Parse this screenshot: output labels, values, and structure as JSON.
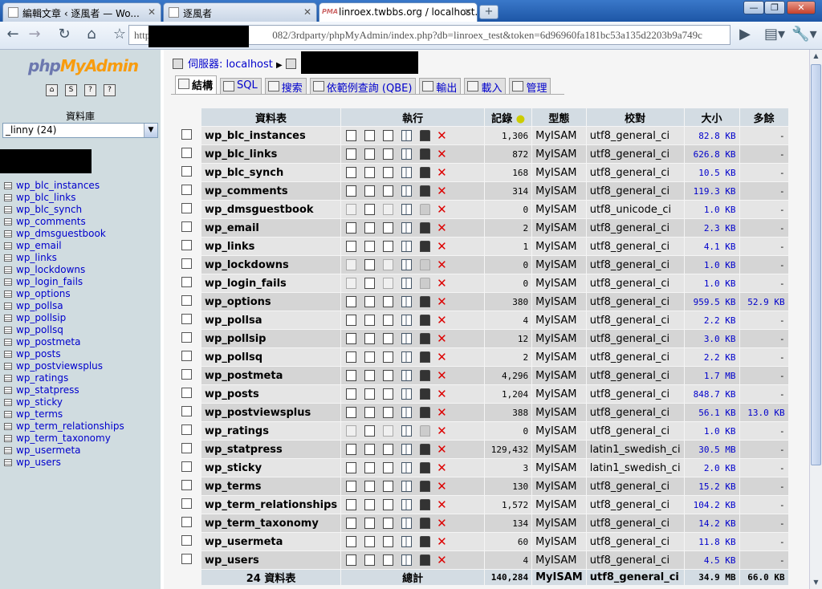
{
  "browser": {
    "tabs": [
      {
        "title": "編輯文章 ‹ 逐風者 — Wo..."
      },
      {
        "title": "逐風者"
      },
      {
        "title": "linroex.twbbs.org / localhost..."
      }
    ],
    "active_tab_index": 2,
    "address_visible": "082/3rdparty/phpMyAdmin/index.php?db=linroex_test&token=6d96960fa181bc53a135d2203b9a749c",
    "address_prefix": "http"
  },
  "sidebar": {
    "logo_php": "php",
    "logo_myadmin": "MyAdmin",
    "db_label": "資料庫",
    "db_selected": "_linny (24)",
    "tables": [
      "wp_blc_instances",
      "wp_blc_links",
      "wp_blc_synch",
      "wp_comments",
      "wp_dmsguestbook",
      "wp_email",
      "wp_links",
      "wp_lockdowns",
      "wp_login_fails",
      "wp_options",
      "wp_pollsa",
      "wp_pollsip",
      "wp_pollsq",
      "wp_postmeta",
      "wp_posts",
      "wp_postviewsplus",
      "wp_ratings",
      "wp_statpress",
      "wp_sticky",
      "wp_terms",
      "wp_term_relationships",
      "wp_term_taxonomy",
      "wp_usermeta",
      "wp_users"
    ]
  },
  "main": {
    "server_label": "伺服器:",
    "server_name": "localhost",
    "tabs": [
      "結構",
      "SQL",
      "搜索",
      "依範例查詢 (QBE)",
      "輸出",
      "載入",
      "管理"
    ],
    "headers": {
      "table": "資料表",
      "action": "執行",
      "records": "記錄",
      "type": "型態",
      "collation": "校對",
      "size": "大小",
      "overhead": "多餘"
    },
    "rows": [
      {
        "name": "wp_blc_instances",
        "records": "1,306",
        "type": "MyISAM",
        "collation": "utf8_general_ci",
        "size": "82.8 KB",
        "overhead": "-",
        "empty": false
      },
      {
        "name": "wp_blc_links",
        "records": "872",
        "type": "MyISAM",
        "collation": "utf8_general_ci",
        "size": "626.8 KB",
        "overhead": "-",
        "empty": false
      },
      {
        "name": "wp_blc_synch",
        "records": "168",
        "type": "MyISAM",
        "collation": "utf8_general_ci",
        "size": "10.5 KB",
        "overhead": "-",
        "empty": false
      },
      {
        "name": "wp_comments",
        "records": "314",
        "type": "MyISAM",
        "collation": "utf8_general_ci",
        "size": "119.3 KB",
        "overhead": "-",
        "empty": false
      },
      {
        "name": "wp_dmsguestbook",
        "records": "0",
        "type": "MyISAM",
        "collation": "utf8_unicode_ci",
        "size": "1.0 KB",
        "overhead": "-",
        "empty": true
      },
      {
        "name": "wp_email",
        "records": "2",
        "type": "MyISAM",
        "collation": "utf8_general_ci",
        "size": "2.3 KB",
        "overhead": "-",
        "empty": false
      },
      {
        "name": "wp_links",
        "records": "1",
        "type": "MyISAM",
        "collation": "utf8_general_ci",
        "size": "4.1 KB",
        "overhead": "-",
        "empty": false
      },
      {
        "name": "wp_lockdowns",
        "records": "0",
        "type": "MyISAM",
        "collation": "utf8_general_ci",
        "size": "1.0 KB",
        "overhead": "-",
        "empty": true
      },
      {
        "name": "wp_login_fails",
        "records": "0",
        "type": "MyISAM",
        "collation": "utf8_general_ci",
        "size": "1.0 KB",
        "overhead": "-",
        "empty": true
      },
      {
        "name": "wp_options",
        "records": "380",
        "type": "MyISAM",
        "collation": "utf8_general_ci",
        "size": "959.5 KB",
        "overhead": "52.9 KB",
        "empty": false
      },
      {
        "name": "wp_pollsa",
        "records": "4",
        "type": "MyISAM",
        "collation": "utf8_general_ci",
        "size": "2.2 KB",
        "overhead": "-",
        "empty": false
      },
      {
        "name": "wp_pollsip",
        "records": "12",
        "type": "MyISAM",
        "collation": "utf8_general_ci",
        "size": "3.0 KB",
        "overhead": "-",
        "empty": false
      },
      {
        "name": "wp_pollsq",
        "records": "2",
        "type": "MyISAM",
        "collation": "utf8_general_ci",
        "size": "2.2 KB",
        "overhead": "-",
        "empty": false
      },
      {
        "name": "wp_postmeta",
        "records": "4,296",
        "type": "MyISAM",
        "collation": "utf8_general_ci",
        "size": "1.7 MB",
        "overhead": "-",
        "empty": false
      },
      {
        "name": "wp_posts",
        "records": "1,204",
        "type": "MyISAM",
        "collation": "utf8_general_ci",
        "size": "848.7 KB",
        "overhead": "-",
        "empty": false
      },
      {
        "name": "wp_postviewsplus",
        "records": "388",
        "type": "MyISAM",
        "collation": "utf8_general_ci",
        "size": "56.1 KB",
        "overhead": "13.0 KB",
        "empty": false
      },
      {
        "name": "wp_ratings",
        "records": "0",
        "type": "MyISAM",
        "collation": "utf8_general_ci",
        "size": "1.0 KB",
        "overhead": "-",
        "empty": true
      },
      {
        "name": "wp_statpress",
        "records": "129,432",
        "type": "MyISAM",
        "collation": "latin1_swedish_ci",
        "size": "30.5 MB",
        "overhead": "-",
        "empty": false
      },
      {
        "name": "wp_sticky",
        "records": "3",
        "type": "MyISAM",
        "collation": "latin1_swedish_ci",
        "size": "2.0 KB",
        "overhead": "-",
        "empty": false
      },
      {
        "name": "wp_terms",
        "records": "130",
        "type": "MyISAM",
        "collation": "utf8_general_ci",
        "size": "15.2 KB",
        "overhead": "-",
        "empty": false
      },
      {
        "name": "wp_term_relationships",
        "records": "1,572",
        "type": "MyISAM",
        "collation": "utf8_general_ci",
        "size": "104.2 KB",
        "overhead": "-",
        "empty": false
      },
      {
        "name": "wp_term_taxonomy",
        "records": "134",
        "type": "MyISAM",
        "collation": "utf8_general_ci",
        "size": "14.2 KB",
        "overhead": "-",
        "empty": false
      },
      {
        "name": "wp_usermeta",
        "records": "60",
        "type": "MyISAM",
        "collation": "utf8_general_ci",
        "size": "11.8 KB",
        "overhead": "-",
        "empty": false
      },
      {
        "name": "wp_users",
        "records": "4",
        "type": "MyISAM",
        "collation": "utf8_general_ci",
        "size": "4.5 KB",
        "overhead": "-",
        "empty": false
      }
    ],
    "footer": {
      "count": "24 資料表",
      "label": "總計",
      "records": "140,284",
      "type": "MyISAM",
      "collation": "utf8_general_ci",
      "size": "34.9 MB",
      "overhead": "66.0 KB"
    }
  }
}
